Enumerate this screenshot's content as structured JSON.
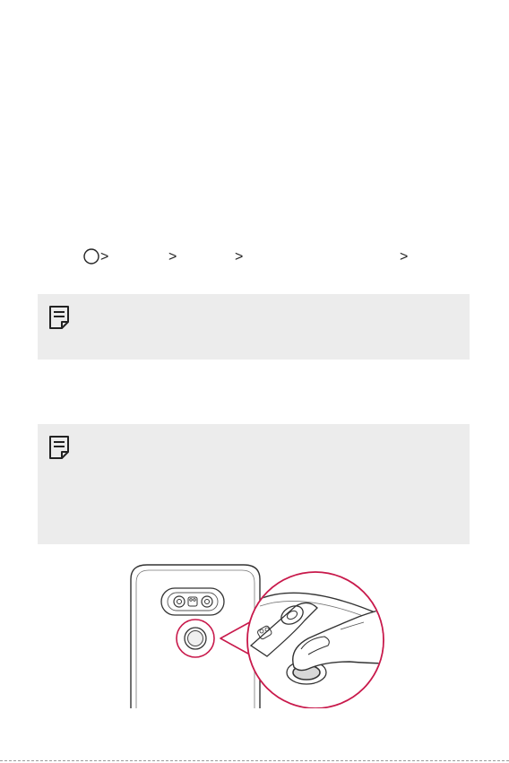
{
  "page": {
    "navigation_path": {
      "separators": [
        ">",
        ">",
        ">",
        ">"
      ]
    },
    "icons": {
      "home_button": "home-circle-icon",
      "note": "note-icon",
      "figure": "fingerprint-sensor-illustration"
    },
    "colors": {
      "note_background": "#ececec",
      "highlight_circle": "#c8194b",
      "line_art": "#333333"
    }
  }
}
